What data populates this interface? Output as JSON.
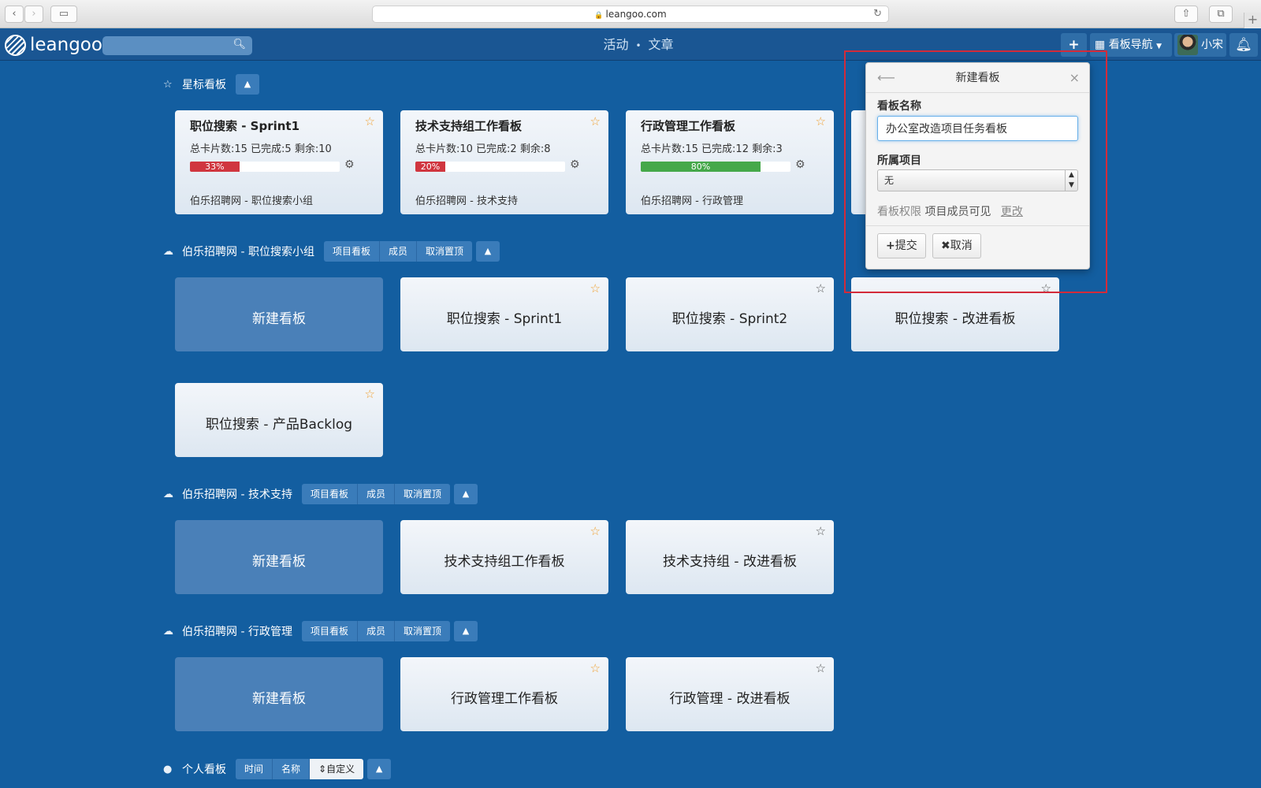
{
  "browser": {
    "url": "leangoo.com",
    "back": "‹",
    "forward": "›",
    "reload": "↻",
    "new_tab": "+"
  },
  "header": {
    "logo_text": "leangoo",
    "nav": [
      "活动",
      "文章"
    ],
    "board_nav_label": "看板导航",
    "user_name": "小宋"
  },
  "starred": {
    "title": "星标看板",
    "cards": [
      {
        "title": "职位搜索 - Sprint1",
        "stats": "总卡片数:15  已完成:5  剩余:10",
        "progress": 0.33,
        "progress_label": "33%",
        "bar_color": "#d0363f",
        "group": "伯乐招聘网 - 职位搜索小组"
      },
      {
        "title": "技术支持组工作看板",
        "stats": "总卡片数:10  已完成:2  剩余:8",
        "progress": 0.2,
        "progress_label": "20%",
        "bar_color": "#d0363f",
        "group": "伯乐招聘网 - 技术支持"
      },
      {
        "title": "行政管理工作看板",
        "stats": "总卡片数:15  已完成:12  剩余:3",
        "progress": 0.8,
        "progress_label": "80%",
        "bar_color": "#45a84a",
        "group": "伯乐招聘网 - 行政管理"
      }
    ]
  },
  "project_buttons": {
    "boards": "项目看板",
    "members": "成员",
    "unpin": "取消置顶"
  },
  "projects": [
    {
      "title": "伯乐招聘网 - 职位搜索小组",
      "new_board": "新建看板",
      "boards": [
        "职位搜索 - Sprint1",
        "职位搜索 - Sprint2",
        "职位搜索 - 改进看板",
        "职位搜索 - 产品Backlog"
      ]
    },
    {
      "title": "伯乐招聘网 - 技术支持",
      "new_board": "新建看板",
      "boards": [
        "技术支持组工作看板",
        "技术支持组 - 改进看板"
      ]
    },
    {
      "title": "伯乐招聘网 - 行政管理",
      "new_board": "新建看板",
      "boards": [
        "行政管理工作看板",
        "行政管理 - 改进看板"
      ]
    }
  ],
  "personal": {
    "title": "个人看板",
    "sort": [
      "时间",
      "名称",
      "自定义"
    ]
  },
  "popup": {
    "title": "新建看板",
    "name_label": "看板名称",
    "name_value": "办公室改造项目任务看板",
    "project_label": "所属项目",
    "project_value": "无",
    "perm_label": "看板权限",
    "perm_value": "项目成员可见",
    "perm_change": "更改",
    "submit": "提交",
    "cancel": "取消"
  }
}
